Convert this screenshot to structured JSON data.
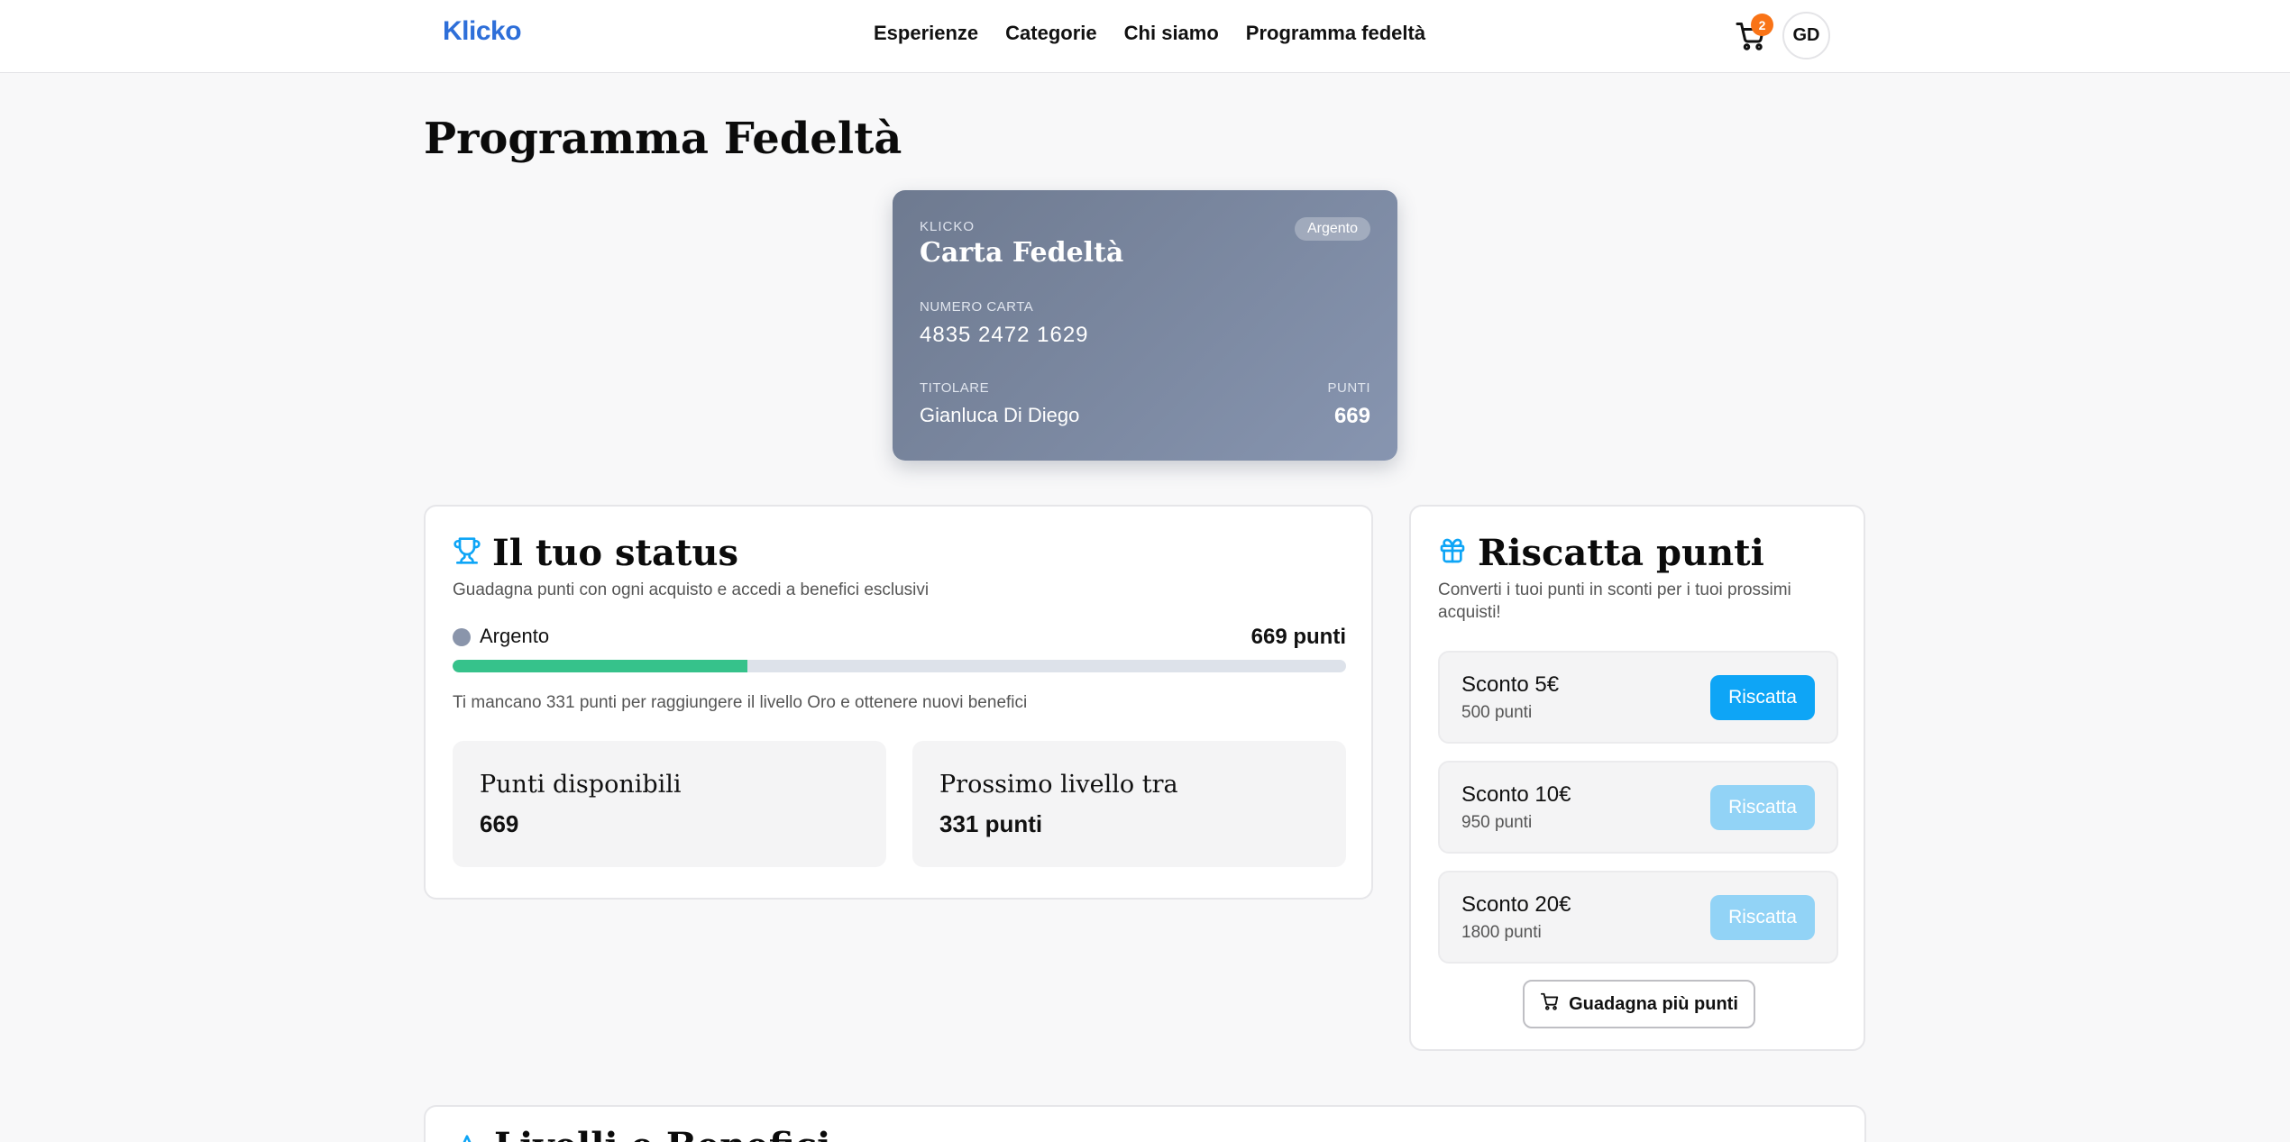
{
  "header": {
    "logo": "Klicko",
    "nav": [
      "Esperienze",
      "Categorie",
      "Chi siamo",
      "Programma fedeltà"
    ],
    "cart_count": "2",
    "avatar_initials": "GD"
  },
  "page": {
    "title": "Programma Fedeltà"
  },
  "card": {
    "brand": "KLICKO",
    "title": "Carta Fedeltà",
    "tier": "Argento",
    "number_label": "NUMERO CARTA",
    "number": "4835 2472 1629",
    "holder_label": "TITOLARE",
    "holder": "Gianluca Di Diego",
    "points_label": "PUNTI",
    "points": "669"
  },
  "status": {
    "title": "Il tuo status",
    "subtitle": "Guadagna punti con ogni acquisto e accedi a benefici esclusivi",
    "tier": "Argento",
    "points": "669 punti",
    "progress": 0.33,
    "hint": "Ti mancano 331 punti per raggiungere il livello Oro e ottenere nuovi benefici",
    "stats": [
      {
        "label": "Punti disponibili",
        "value": "669"
      },
      {
        "label": "Prossimo livello tra",
        "value": "331 punti"
      }
    ]
  },
  "redeem": {
    "title": "Riscatta punti",
    "subtitle": "Converti i tuoi punti in sconti per i tuoi prossimi acquisti!",
    "rewards": [
      {
        "title": "Sconto 5€",
        "points": "500 punti",
        "button": "Riscatta"
      },
      {
        "title": "Sconto 10€",
        "points": "950 punti",
        "button": "Riscatta"
      },
      {
        "title": "Sconto 20€",
        "points": "1800 punti",
        "button": "Riscatta"
      }
    ],
    "more_button": "Guadagna più punti"
  },
  "levels": {
    "title": "Livelli e Benefici"
  },
  "colors": {
    "accent": "#0ea5f6",
    "brand": "#2e6fd9",
    "progress": "#36c28b",
    "badge": "#f97316"
  }
}
